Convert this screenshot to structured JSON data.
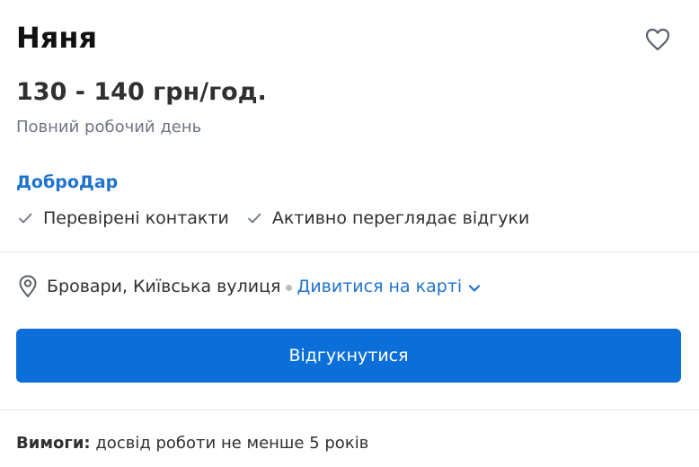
{
  "job": {
    "title": "Няня",
    "salary": "130 - 140 грн/год.",
    "schedule": "Повний робочий день",
    "company": "ДоброДар"
  },
  "badges": [
    {
      "icon": "check-icon",
      "label": "Перевірені контакти"
    },
    {
      "icon": "check-icon",
      "label": "Активно переглядає відгуки"
    }
  ],
  "location": {
    "icon": "map-pin-icon",
    "address": "Бровари, Київська вулиця",
    "map_link": "Дивитися на карті"
  },
  "actions": {
    "favorite_icon": "heart-icon",
    "respond_label": "Відгукнутися"
  },
  "requirements": {
    "label": "Вимоги:",
    "text": " досвід роботи не менше 5 років"
  },
  "colors": {
    "accent": "#0c6fd9",
    "link": "#1f73cc",
    "muted": "#6e7480"
  }
}
